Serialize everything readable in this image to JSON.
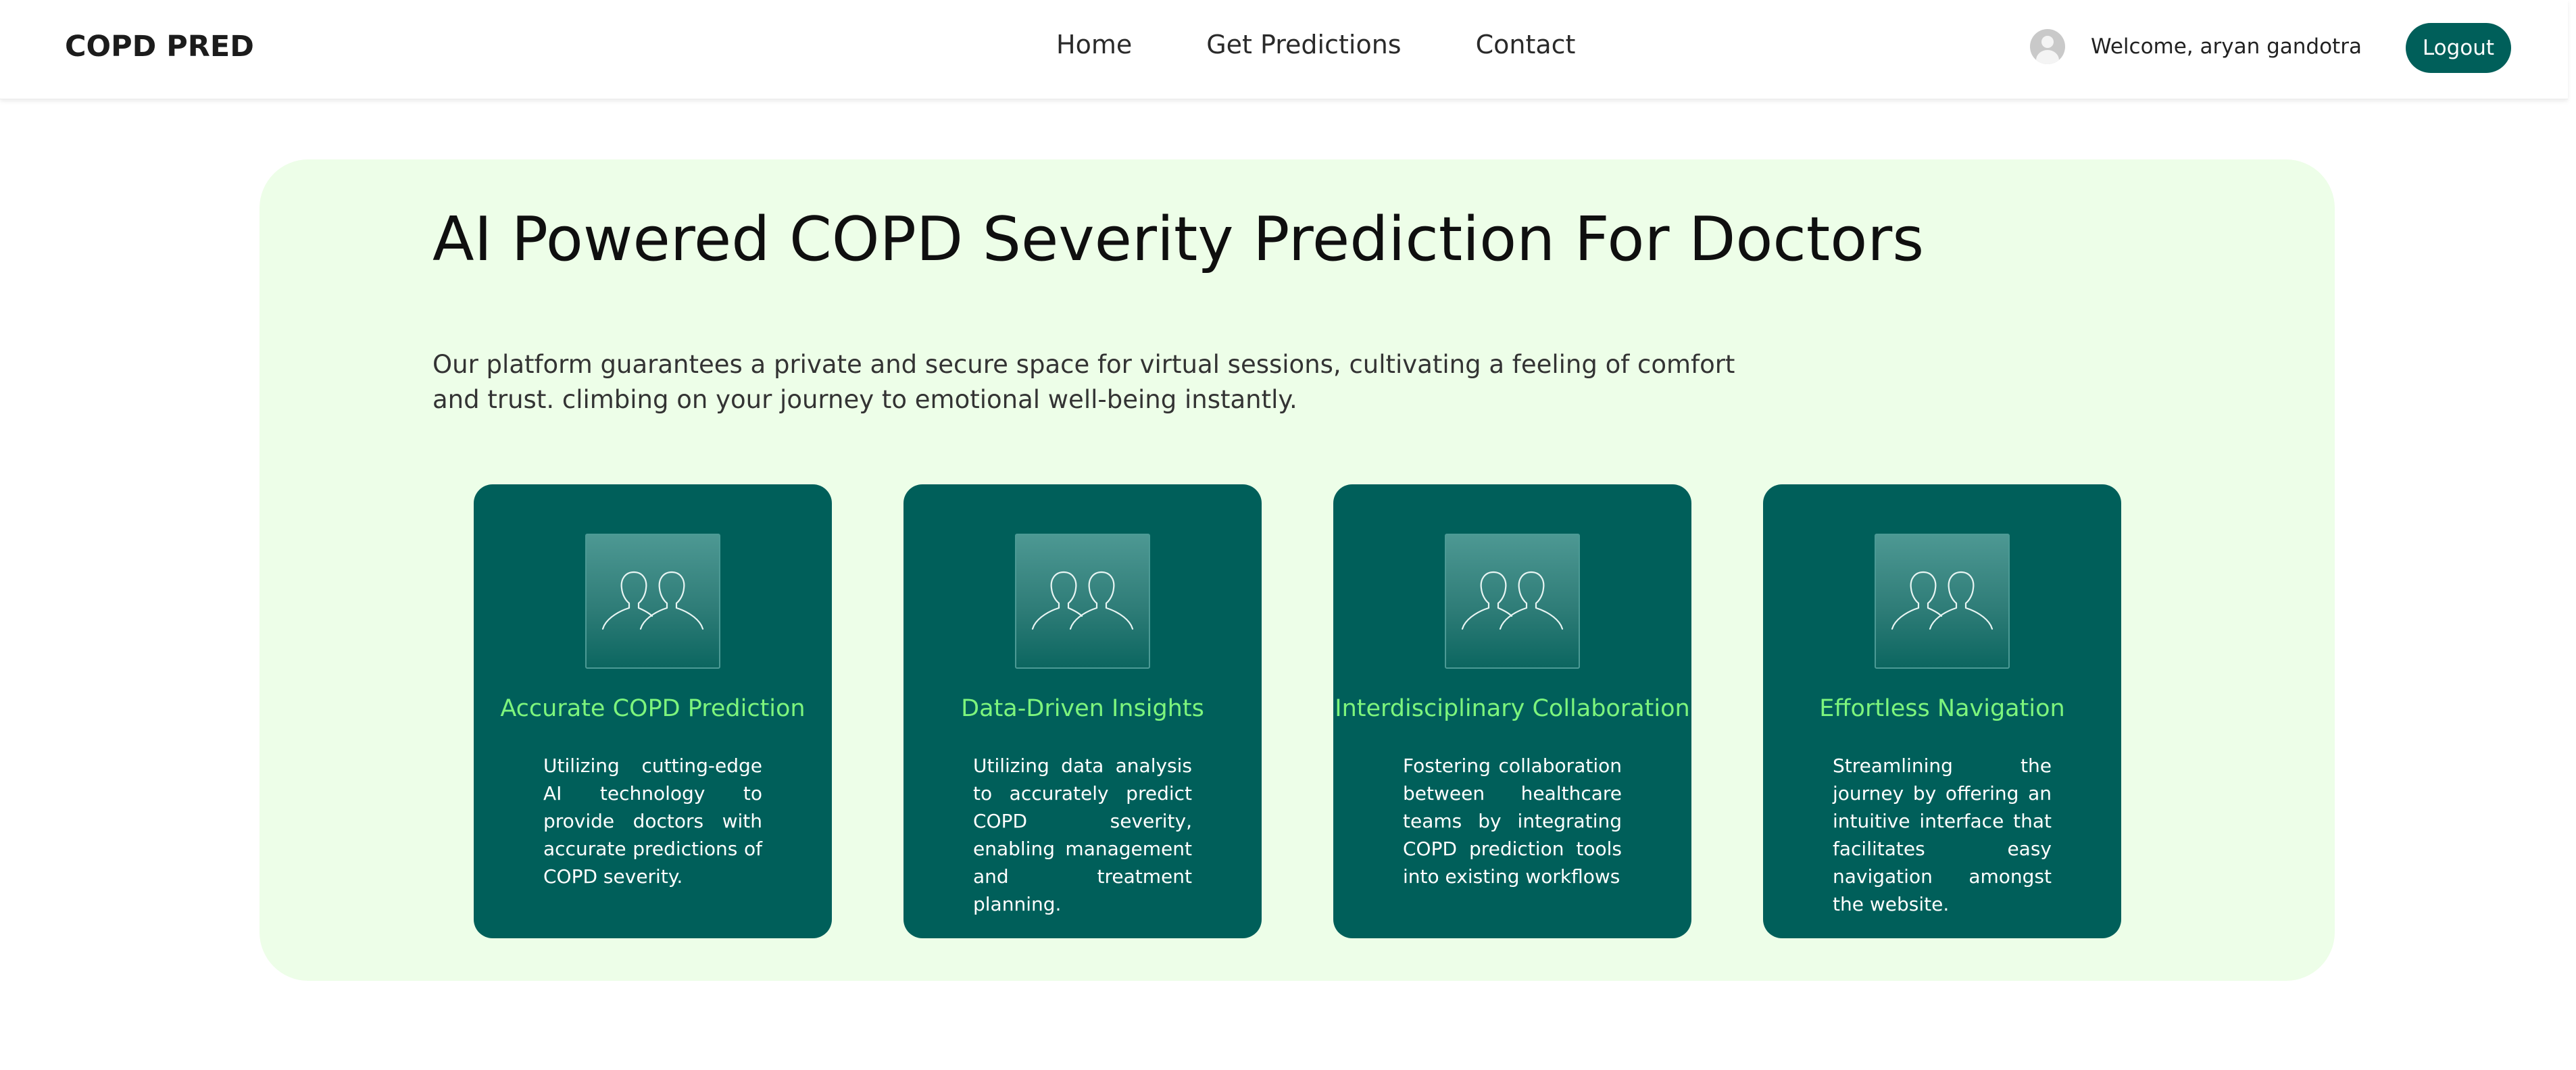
{
  "header": {
    "brand": "COPD PRED",
    "nav": [
      {
        "label": "Home"
      },
      {
        "label": "Get Predictions"
      },
      {
        "label": "Contact"
      }
    ],
    "user": {
      "welcome": "Welcome, aryan gandotra",
      "avatar_icon": "user-avatar-icon"
    },
    "logout_label": "Logout"
  },
  "hero": {
    "title": "AI Powered COPD Severity Prediction For Doctors",
    "description": "Our platform guarantees a private and secure space for virtual sessions, cultivating a feeling of comfort and trust. climbing on your journey to emotional well-being instantly."
  },
  "features": [
    {
      "icon": "people-icon",
      "title": "Accurate COPD Prediction",
      "body": "Utilizing cutting-edge AI technology to provide doctors with accurate predictions of COPD severity."
    },
    {
      "icon": "people-icon",
      "title": "Data-Driven Insights",
      "body": "Utilizing data analysis to accurately predict COPD severity, enabling management and treatment planning."
    },
    {
      "icon": "people-icon",
      "title": "Interdisciplinary Collaboration",
      "body": "Fostering collaboration between healthcare teams by integrating COPD prediction tools into existing workflows"
    },
    {
      "icon": "people-icon",
      "title": "Effortless Navigation",
      "body": "Streamlining the journey by offering an intuitive interface that facilitates easy navigation amongst the website."
    }
  ],
  "colors": {
    "primary": "#005f5a",
    "hero_background": "#edfee8",
    "card_title": "#7df57d",
    "card_text": "#ffffff"
  }
}
